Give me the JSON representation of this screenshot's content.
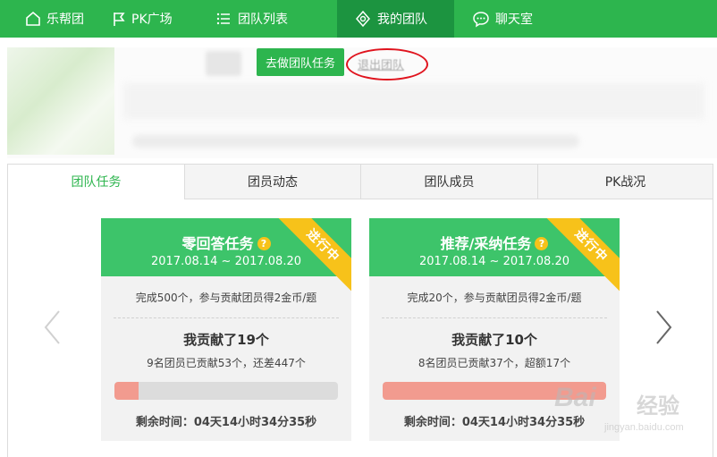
{
  "nav": {
    "items": [
      {
        "label": "乐帮团",
        "icon": "home-icon"
      },
      {
        "label": "PK广场",
        "icon": "flag-icon"
      },
      {
        "label": "团队列表",
        "icon": "list-icon"
      },
      {
        "label": "我的团队",
        "icon": "team-icon",
        "active": true
      },
      {
        "label": "聊天室",
        "icon": "chat-icon"
      }
    ],
    "color": "#2db54e",
    "active_color": "#1c9440"
  },
  "banner": {
    "do_task_button": "去做团队任务",
    "quit_link": "退出团队"
  },
  "tabs": [
    {
      "label": "团队任务",
      "active": true
    },
    {
      "label": "团员动态"
    },
    {
      "label": "团队成员"
    },
    {
      "label": "PK战况"
    }
  ],
  "cards": [
    {
      "title": "零回答任务",
      "date": "2017.08.14 ~ 2017.08.20",
      "ribbon": "进行中",
      "rule": "完成500个，参与贡献团员得2金币/题",
      "contribution": "我贡献了19个",
      "status": "9名团员已贡献53个，还差447个",
      "progress_fraction": 0.106,
      "remaining": "剩余时间：04天14小时34分35秒"
    },
    {
      "title": "推荐/采纳任务",
      "date": "2017.08.14 ~ 2017.08.20",
      "ribbon": "进行中",
      "rule": "完成20个，参与贡献团员得2金币/题",
      "contribution": "我贡献了10个",
      "status": "8名团员已贡献37个，超额17个",
      "progress_fraction": 1.0,
      "remaining": "剩余时间：04天14小时34分35秒"
    }
  ],
  "watermark": {
    "brand": "Bai",
    "cn": "经验",
    "url": "jingyan.baidu.com"
  },
  "colors": {
    "accent": "#2db54e",
    "card_head": "#3dc46a",
    "ribbon": "#f7c21a",
    "progress": "#f29b8f",
    "annotation": "#e0141e"
  }
}
